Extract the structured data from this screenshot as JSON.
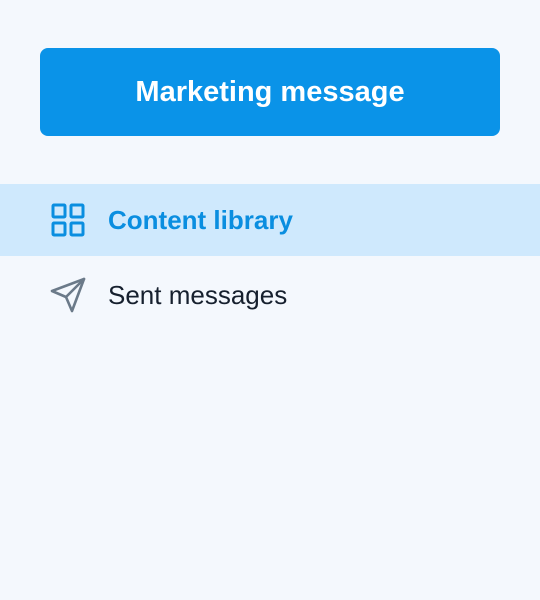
{
  "actions": {
    "primary_label": "Marketing message"
  },
  "nav": {
    "items": [
      {
        "label": "Content library",
        "icon": "grid-icon",
        "active": true
      },
      {
        "label": "Sent messages",
        "icon": "send-icon",
        "active": false
      }
    ]
  },
  "colors": {
    "primary": "#0a93e8",
    "active_bg": "#cfe9fd",
    "active_text": "#0a8ee0",
    "text": "#16202e",
    "icon_muted": "#6b7a89",
    "background": "#f4f8fd"
  }
}
